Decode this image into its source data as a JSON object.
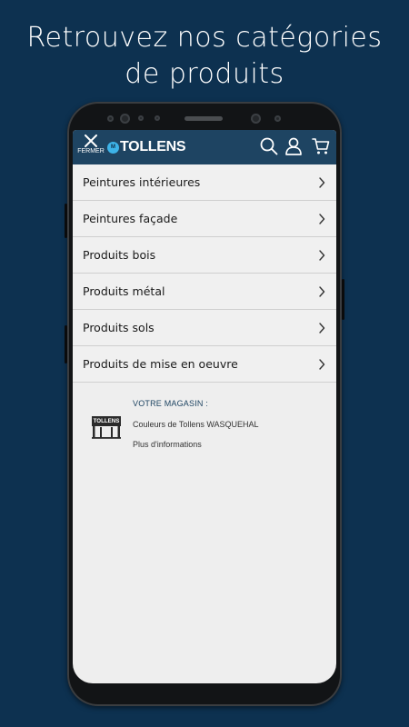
{
  "headline": {
    "line1": "Retrouvez nos catégories",
    "line2": "de produits"
  },
  "app": {
    "close_label": "FERMER",
    "logo_badge": "M",
    "logo_text": "TOLLENS",
    "icons": [
      "close-icon",
      "search-icon",
      "user-icon",
      "cart-icon"
    ],
    "accent_color": "#1e4462"
  },
  "menu": {
    "items": [
      {
        "label": "Peintures intérieures"
      },
      {
        "label": "Peintures façade"
      },
      {
        "label": "Produits bois"
      },
      {
        "label": "Produits métal"
      },
      {
        "label": "Produits sols"
      },
      {
        "label": "Produits de mise en oeuvre"
      }
    ]
  },
  "store": {
    "title": "VOTRE MAGASIN :",
    "name": "Couleurs de Tollens WASQUEHAL",
    "more": "Plus d'informations",
    "icon_text": "TOLLENS"
  }
}
